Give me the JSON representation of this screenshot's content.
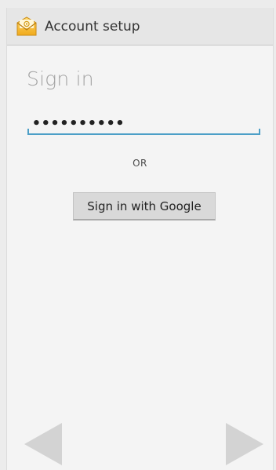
{
  "action_bar": {
    "title": "Account setup",
    "icon": "email-app-icon"
  },
  "form": {
    "heading": "Sign in",
    "password_value": "••••••••••",
    "password_icon": "password-field",
    "separator_text": "OR",
    "google_button_label": "Sign in with Google"
  },
  "navigation": {
    "previous_icon": "previous-arrow-icon",
    "next_icon": "next-arrow-icon"
  },
  "colors": {
    "action_bar": "#e6e6e6",
    "accent": "#4c9fc7",
    "background": "#f4f4f4",
    "button": "#d9d9d9",
    "arrow": "#d3d3d3"
  }
}
